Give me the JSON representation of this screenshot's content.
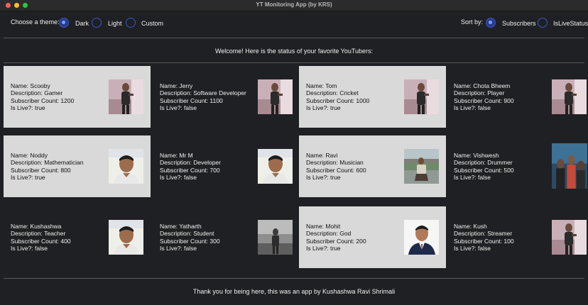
{
  "window": {
    "title": "YT Monitoring App (by KRS)"
  },
  "theme": {
    "label": "Choose a theme:",
    "options": [
      "Dark",
      "Light",
      "Custom"
    ],
    "selected": "Dark"
  },
  "sort": {
    "label": "Sort by:",
    "options": [
      "Subscribers",
      "IsLiveStatus"
    ],
    "selected": "Subscribers"
  },
  "welcome": "Welcome! Here is the status of your favorite YouTubers:",
  "footer": "Thank you for being here, this was an app by Kushashwa Ravi Shrimali",
  "colors": {
    "live_card_bg": "#d8d9d8",
    "app_bg": "#1f2023",
    "radio_accent": "#3a54c8"
  },
  "youtubers": [
    {
      "name": "Name: Scooby",
      "desc": "Description: Gamer",
      "subs": "Subscriber Count: 1200",
      "live": "Is Live?: true",
      "is_live": true,
      "photo": "stage-photo"
    },
    {
      "name": "Name: Jerry",
      "desc": "Description: Software Developer",
      "subs": "Subscriber Count: 1100",
      "live": "Is Live?: false",
      "is_live": false,
      "photo": "stage-photo"
    },
    {
      "name": "Name: Tom",
      "desc": "Description: Cricket",
      "subs": "Subscriber Count: 1000",
      "live": "Is Live?: true",
      "is_live": true,
      "photo": "stage-photo"
    },
    {
      "name": "Name: Chota Bheem",
      "desc": "Description: Player",
      "subs": "Subscriber Count: 900",
      "live": "Is Live?: false",
      "is_live": false,
      "photo": "stage-photo"
    },
    {
      "name": "Name: Noddy",
      "desc": "Description: Mathematician",
      "subs": "Subscriber Count: 800",
      "live": "Is Live?: true",
      "is_live": true,
      "photo": "portrait-photo"
    },
    {
      "name": "Name: Mr M",
      "desc": "Description: Developer",
      "subs": "Subscriber Count: 700",
      "live": "Is Live?: false",
      "is_live": false,
      "photo": "portrait-photo"
    },
    {
      "name": "Name: Ravi",
      "desc": "Description: Musician",
      "subs": "Subscriber Count: 600",
      "live": "Is Live?: true",
      "is_live": true,
      "photo": "outdoor-photo"
    },
    {
      "name": "Name: Vishwesh",
      "desc": "Description: Drummer",
      "subs": "Subscriber Count: 500",
      "live": "Is Live?: false",
      "is_live": false,
      "photo": "group-photo"
    },
    {
      "name": "Name: Kushashwa",
      "desc": "Description: Teacher",
      "subs": "Subscriber Count: 400",
      "live": "Is Live?: false",
      "is_live": false,
      "photo": "portrait-photo"
    },
    {
      "name": "Name: Yatharth",
      "desc": "Description: Student",
      "subs": "Subscriber Count: 300",
      "live": "Is Live?: false",
      "is_live": false,
      "photo": "bw-photo"
    },
    {
      "name": "Name: Mohit",
      "desc": "Description: God",
      "subs": "Subscriber Count: 200",
      "live": "Is Live?: true",
      "is_live": true,
      "photo": "formal-portrait-photo"
    },
    {
      "name": "Name: Kush",
      "desc": "Description: Streamer",
      "subs": "Subscriber Count: 100",
      "live": "Is Live?: false",
      "is_live": false,
      "photo": "stage-photo"
    }
  ]
}
